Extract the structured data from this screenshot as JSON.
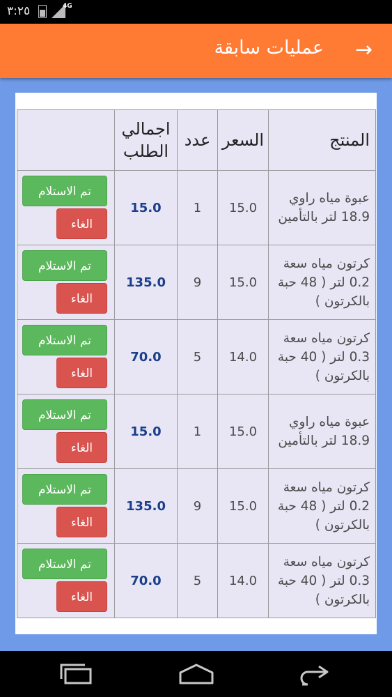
{
  "status_bar": {
    "time": "٣:٢٥",
    "network": "4G"
  },
  "app_bar": {
    "title": "عمليات سابقة",
    "back_icon": "arrow-right-icon",
    "background": "#ff7a33"
  },
  "table": {
    "headers": {
      "product": "المنتج",
      "price": "السعر",
      "qty": "عدد",
      "total": "اجمالي الطلب",
      "actions": ""
    },
    "receive_label": "تم الاستلام",
    "cancel_label": "الغاء",
    "rows": [
      {
        "product": "عبوة مياه راوي 18.9 لتر بالتأمين",
        "price": "15.0",
        "qty": "1",
        "total": "15.0"
      },
      {
        "product": "كرتون مياه سعة 0.2 لتر ( 48 حبة بالكرتون )",
        "price": "15.0",
        "qty": "9",
        "total": "135.0"
      },
      {
        "product": "كرتون مياه سعة 0.3 لتر ( 40 حبة بالكرتون )",
        "price": "14.0",
        "qty": "5",
        "total": "70.0"
      },
      {
        "product": "عبوة مياه راوي 18.9 لتر بالتأمين",
        "price": "15.0",
        "qty": "1",
        "total": "15.0"
      },
      {
        "product": "كرتون مياه سعة 0.2 لتر ( 48 حبة بالكرتون )",
        "price": "15.0",
        "qty": "9",
        "total": "135.0"
      },
      {
        "product": "كرتون مياه سعة 0.3 لتر ( 40 حبة بالكرتون )",
        "price": "14.0",
        "qty": "5",
        "total": "70.0"
      }
    ]
  },
  "nav_bar": {
    "recents_icon": "recent-apps-icon",
    "home_icon": "home-icon",
    "back_icon": "back-icon"
  },
  "colors": {
    "receive": "#5cb85c",
    "cancel": "#d9534f",
    "total_text": "#1c3f8a",
    "page_bg": "#6f9ae8"
  }
}
